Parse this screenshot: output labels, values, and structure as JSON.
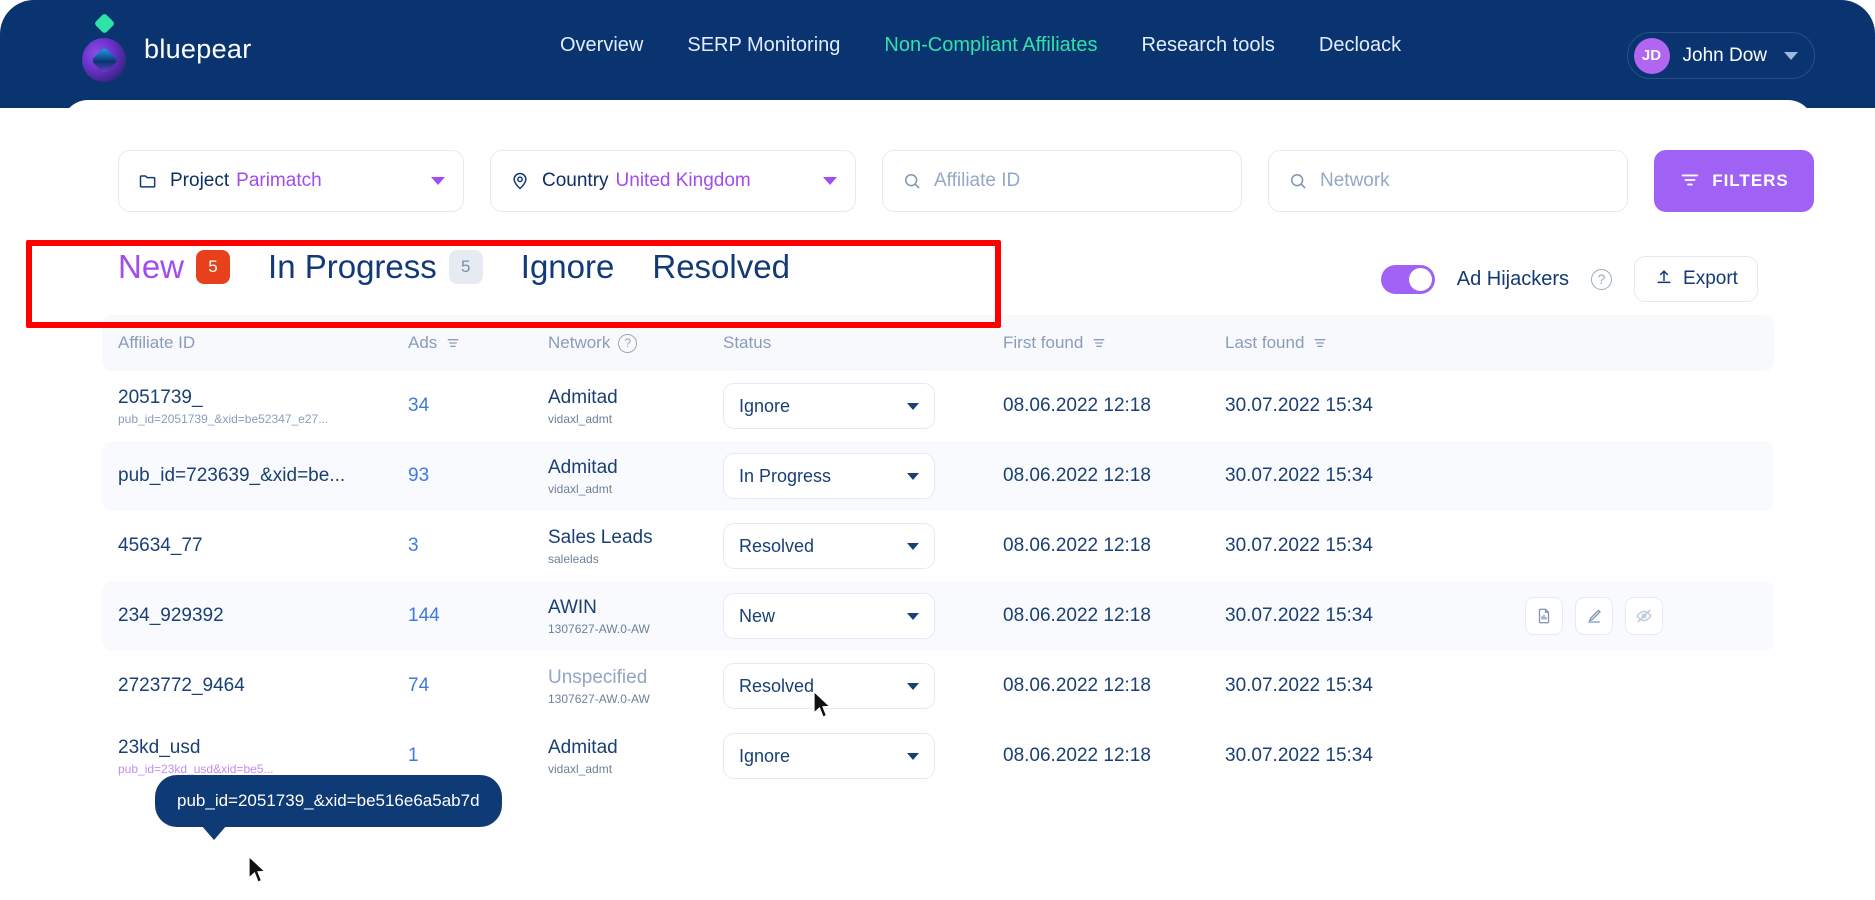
{
  "brand": {
    "name": "bluepear"
  },
  "nav": {
    "items": [
      {
        "label": "Overview",
        "active": false
      },
      {
        "label": "SERP Monitoring",
        "active": false
      },
      {
        "label": "Non-Compliant Affiliates",
        "active": true
      },
      {
        "label": "Research tools",
        "active": false
      },
      {
        "label": "Decloack",
        "active": false
      }
    ],
    "active_color": "#2fe3a8"
  },
  "user": {
    "initials": "JD",
    "name": "John Dow"
  },
  "filters": {
    "project": {
      "label": "Project",
      "value": "Parimatch"
    },
    "country": {
      "label": "Country",
      "value": "United Kingdom"
    },
    "affiliate_id": {
      "placeholder": "Affiliate ID",
      "value": ""
    },
    "network": {
      "placeholder": "Network",
      "value": ""
    },
    "filters_button": "FILTERS",
    "accent_color": "#a061f5"
  },
  "tabs": [
    {
      "label": "New",
      "badge": "5",
      "badge_style": "red",
      "active": true
    },
    {
      "label": "In Progress",
      "badge": "5",
      "badge_style": "grey",
      "active": false
    },
    {
      "label": "Ignore",
      "badge": "",
      "badge_style": "none",
      "active": false
    },
    {
      "label": "Resolved",
      "badge": "",
      "badge_style": "none",
      "active": false
    }
  ],
  "toolbar": {
    "toggle_label": "Ad Hijackers",
    "toggle_on": true,
    "help_glyph": "?",
    "export_label": "Export"
  },
  "table": {
    "columns": [
      {
        "label": "Affiliate ID",
        "sortable": false,
        "help": false
      },
      {
        "label": "Ads",
        "sortable": true,
        "help": false
      },
      {
        "label": "Network",
        "sortable": false,
        "help": true
      },
      {
        "label": "Status",
        "sortable": false,
        "help": false
      },
      {
        "label": "First found",
        "sortable": true,
        "help": false
      },
      {
        "label": "Last found",
        "sortable": true,
        "help": false
      }
    ],
    "rows": [
      {
        "affiliate_id": "2051739_",
        "affiliate_sub": "pub_id=2051739_&xid=be52347_e27...",
        "affiliate_sub_purple": false,
        "ads": "34",
        "network": "Admitad",
        "network_sub": "vidaxl_admt",
        "network_muted": false,
        "status": "Ignore",
        "first_found": "08.06.2022 12:18",
        "last_found": "30.07.2022 15:34",
        "show_actions": false
      },
      {
        "affiliate_id": "pub_id=723639_&xid=be...",
        "affiliate_sub": "",
        "affiliate_sub_purple": false,
        "ads": "93",
        "network": "Admitad",
        "network_sub": "vidaxl_admt",
        "network_muted": false,
        "status": "In Progress",
        "first_found": "08.06.2022 12:18",
        "last_found": "30.07.2022 15:34",
        "show_actions": false
      },
      {
        "affiliate_id": "45634_77",
        "affiliate_sub": "",
        "affiliate_sub_purple": false,
        "ads": "3",
        "network": "Sales Leads",
        "network_sub": "saleleads",
        "network_muted": false,
        "status": "Resolved",
        "first_found": "08.06.2022 12:18",
        "last_found": "30.07.2022 15:34",
        "show_actions": false
      },
      {
        "affiliate_id": "234_929392",
        "affiliate_sub": "",
        "affiliate_sub_purple": false,
        "ads": "144",
        "network": "AWIN",
        "network_sub": "1307627-AW.0-AW",
        "network_muted": false,
        "status": "New",
        "first_found": "08.06.2022 12:18",
        "last_found": "30.07.2022 15:34",
        "show_actions": true
      },
      {
        "affiliate_id": "2723772_9464",
        "affiliate_sub": "",
        "affiliate_sub_purple": false,
        "ads": "74",
        "network": "Unspecified",
        "network_sub": "1307627-AW.0-AW",
        "network_muted": true,
        "status": "Resolved",
        "first_found": "08.06.2022 12:18",
        "last_found": "30.07.2022 15:34",
        "show_actions": false
      },
      {
        "affiliate_id": "23kd_usd",
        "affiliate_sub": "pub_id=23kd_usd&xid=be5...",
        "affiliate_sub_purple": true,
        "ads": "1",
        "network": "Admitad",
        "network_sub": "vidaxl_admt",
        "network_muted": false,
        "status": "Ignore",
        "first_found": "08.06.2022 12:18",
        "last_found": "30.07.2022 15:34",
        "show_actions": false
      }
    ]
  },
  "tooltip": {
    "text": "pub_id=2051739_&xid=be516e6a5ab7d"
  },
  "annotation": {
    "color": "#ff0000"
  }
}
